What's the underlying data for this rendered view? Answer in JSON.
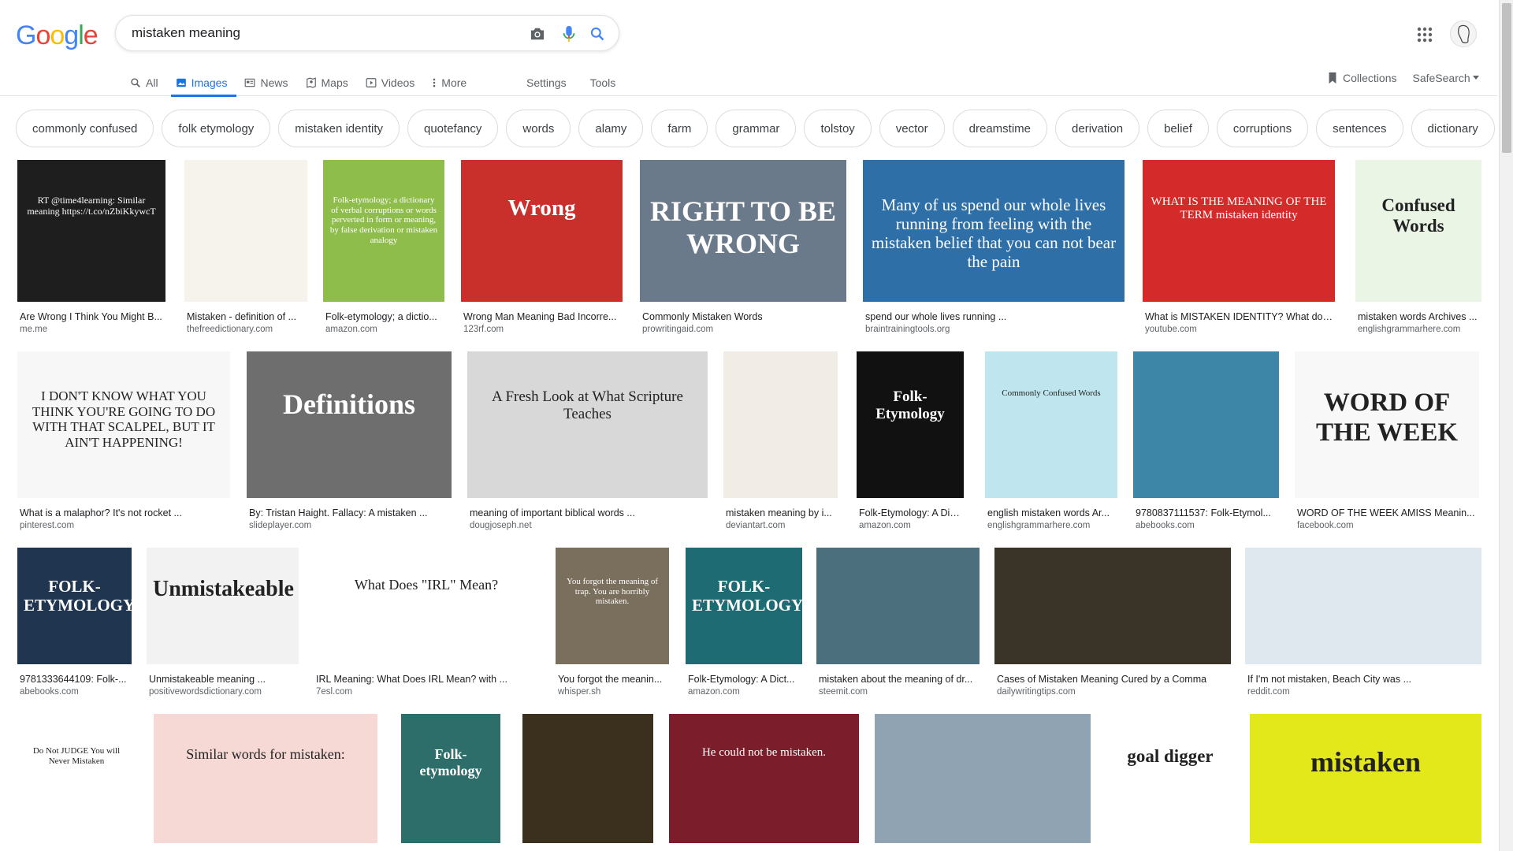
{
  "logo_letters": [
    "G",
    "o",
    "o",
    "g",
    "l",
    "e"
  ],
  "search": {
    "query": "mistaken meaning"
  },
  "tabs": [
    {
      "label": "All",
      "icon": "search-icon"
    },
    {
      "label": "Images",
      "icon": "image-icon",
      "active": true
    },
    {
      "label": "News",
      "icon": "news-icon"
    },
    {
      "label": "Maps",
      "icon": "map-pin-icon"
    },
    {
      "label": "Videos",
      "icon": "play-icon"
    },
    {
      "label": "More",
      "icon": "more-vert-icon"
    }
  ],
  "tools": {
    "settings": "Settings",
    "tools": "Tools"
  },
  "right_links": {
    "collections": "Collections",
    "safesearch": "SafeSearch"
  },
  "chips": [
    "commonly confused",
    "folk etymology",
    "mistaken identity",
    "quotefancy",
    "words",
    "alamy",
    "farm",
    "grammar",
    "tolstoy",
    "vector",
    "dreamstime",
    "derivation",
    "belief",
    "corruptions",
    "sentences",
    "dictionary"
  ],
  "images": [
    {
      "caption": "Are Wrong I Think You Might B...",
      "source": "me.me",
      "thumb_text": "RT @time4learning: Similar meaning https://t.co/nZbiKkywcT",
      "bg": "#1e1e1e"
    },
    {
      "caption": "Mistaken - definition of ...",
      "source": "thefreedictionary.com",
      "bg": "#f5f3ec"
    },
    {
      "caption": "Folk-etymology; a dictio...",
      "source": "amazon.com",
      "thumb_text": "Folk-etymology; a dictionary of verbal corruptions or words perverted in form or meaning, by false derivation or mistaken analogy",
      "bg": "#8fbd4b"
    },
    {
      "caption": "Wrong Man Meaning Bad Incorre...",
      "source": "123rf.com",
      "thumb_text": "Wrong",
      "bg": "#c9302c"
    },
    {
      "caption": "Commonly Mistaken Words",
      "source": "prowritingaid.com",
      "thumb_text": "RIGHT TO BE WRONG",
      "bg": "#6b7a8a"
    },
    {
      "caption": "spend our whole lives running ...",
      "source": "braintrainingtools.org",
      "thumb_text": "Many of us spend our whole lives running from feeling with the mistaken belief that you can not bear the pain",
      "bg": "#2f6fa8"
    },
    {
      "caption": "What is MISTAKEN IDENTITY? What doe...",
      "source": "youtube.com",
      "thumb_text": "WHAT IS THE MEANING OF THE TERM mistaken identity",
      "bg": "#d42a2a"
    },
    {
      "caption": "mistaken words Archives ...",
      "source": "englishgrammarhere.com",
      "thumb_text": "Confused Words",
      "bg": "#eaf5e6"
    },
    {
      "caption": "What is a malaphor? It's not rocket ...",
      "source": "pinterest.com",
      "thumb_text": "I DON'T KNOW WHAT YOU THINK YOU'RE GOING TO DO WITH THAT SCALPEL, BUT IT AIN'T HAPPENING!",
      "bg": "#f7f7f7"
    },
    {
      "caption": "By: Tristan Haight. Fallacy: A mistaken ...",
      "source": "slideplayer.com",
      "thumb_text": "Definitions",
      "bg": "#6e6e6e"
    },
    {
      "caption": "meaning of important biblical words ...",
      "source": "dougjoseph.net",
      "thumb_text": "A Fresh Look at What Scripture Teaches",
      "bg": "#d8d8d8"
    },
    {
      "caption": "mistaken meaning by i...",
      "source": "deviantart.com",
      "bg": "#f1ece6"
    },
    {
      "caption": "Folk-Etymology: A Dict...",
      "source": "amazon.com",
      "thumb_text": "Folk-Etymology",
      "bg": "#111111"
    },
    {
      "caption": "english mistaken words Ar...",
      "source": "englishgrammarhere.com",
      "thumb_text": "Commonly Confused Words",
      "bg": "#bfe6ee"
    },
    {
      "caption": "9780837111537: Folk-Etymol...",
      "source": "abebooks.com",
      "bg": "#3d86a8"
    },
    {
      "caption": "WORD OF THE WEEK AMISS Meanin...",
      "source": "facebook.com",
      "thumb_text": "WORD OF THE WEEK",
      "bg": "#f8f8f8"
    },
    {
      "caption": "9781333644109: Folk-...",
      "source": "abebooks.com",
      "thumb_text": "FOLK-ETYMOLOGY",
      "bg": "#1f3550"
    },
    {
      "caption": "Unmistakeable meaning ...",
      "source": "positivewordsdictionary.com",
      "thumb_text": "Unmistakeable",
      "bg": "#f2f2f2"
    },
    {
      "caption": "IRL Meaning: What Does IRL Mean? with ...",
      "source": "7esl.com",
      "thumb_text": "What Does \"IRL\" Mean?",
      "bg": "#fff"
    },
    {
      "caption": "You forgot the meanin...",
      "source": "whisper.sh",
      "thumb_text": "You forgot the meaning of trap. You are horribly mistaken.",
      "bg": "#7a6e5c"
    },
    {
      "caption": "Folk-Etymology: A Dict...",
      "source": "amazon.com",
      "thumb_text": "FOLK-ETYMOLOGY",
      "bg": "#1f6b73"
    },
    {
      "caption": "mistaken about the meaning of dr...",
      "source": "steemit.com",
      "bg": "#4b6f7d"
    },
    {
      "caption": "Cases of Mistaken Meaning Cured by a Comma",
      "source": "dailywritingtips.com",
      "bg": "#3a3428"
    },
    {
      "caption": "If I'm not mistaken, Beach City was ...",
      "source": "reddit.com",
      "bg": "#dfe8ef"
    },
    {
      "thumb_text": "Do Not JUDGE You will Never Mistaken",
      "bg": "#ffffff"
    },
    {
      "thumb_text": "Similar words for mistaken:",
      "bg": "#f6d9d5"
    },
    {
      "thumb_text": "Folk-etymology",
      "bg": "#2d6d6a"
    },
    {
      "bg": "#3b2f1e"
    },
    {
      "thumb_text": "He could not be mistaken.",
      "bg": "#7b1d2a"
    },
    {
      "bg": "#8fa3b2"
    },
    {
      "thumb_text": "goal digger",
      "bg": "#ffffff"
    },
    {
      "thumb_text": "mistaken",
      "bg": "#e3e81b"
    }
  ]
}
